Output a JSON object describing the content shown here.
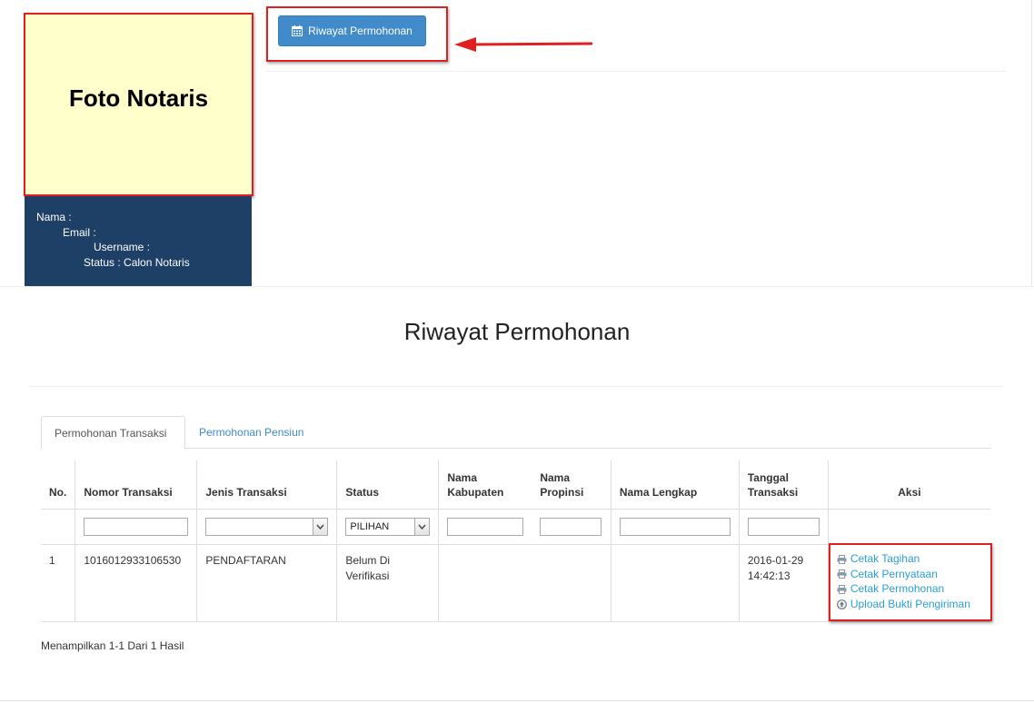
{
  "profile": {
    "photo_label": "Foto Notaris",
    "nama": "Nama :",
    "email": "Email :",
    "username": "Username :",
    "status": "Status : Calon Notaris"
  },
  "header": {
    "history_button_label": "Riwayat Permohonan"
  },
  "section": {
    "title": "Riwayat Permohonan"
  },
  "tabs": [
    {
      "label": "Permohonan Transaksi",
      "active": true
    },
    {
      "label": "Permohonan Pensiun",
      "active": false
    }
  ],
  "table": {
    "columns": {
      "no": "No.",
      "nomor": "Nomor Transaksi",
      "jenis": "Jenis Transaksi",
      "status": "Status",
      "kab_1": "Nama",
      "kab_2": "Kabupaten",
      "prop_1": "Nama",
      "prop_2": "Propinsi",
      "nama_lengkap": "Nama Lengkap",
      "tgl_1": "Tanggal",
      "tgl_2": "Transaksi",
      "aksi": "Aksi"
    },
    "filters": {
      "jenis_selected": "",
      "status_selected": "PILIHAN"
    },
    "rows": [
      {
        "no": "1",
        "nomor": "1016012933106530",
        "jenis": "PENDAFTARAN",
        "status_line1": "Belum Di",
        "status_line2": "Verifikasi",
        "kabupaten": "",
        "propinsi": "",
        "nama_lengkap": "",
        "tanggal": "2016-01-29",
        "jam": "14:42:13",
        "actions": {
          "tagihan": "Cetak Tagihan",
          "pernyataan": "Cetak Pernyataan",
          "permohonan": "Cetak Permohonan",
          "upload": "Upload Bukti Pengiriman"
        }
      }
    ]
  },
  "footer": {
    "summary": "Menampilkan 1-1 Dari 1 Hasil"
  },
  "icons": {
    "calendar": "calendar-icon",
    "print": "print-icon",
    "upload": "upload-circle-icon",
    "dropdown": "chevron-down-icon"
  },
  "colors": {
    "primary_button": "#428bca",
    "profile_panel": "#1e3f66",
    "photo_box": "#ffffcc",
    "highlight": "#e02020",
    "link": "#2a9fd6"
  }
}
